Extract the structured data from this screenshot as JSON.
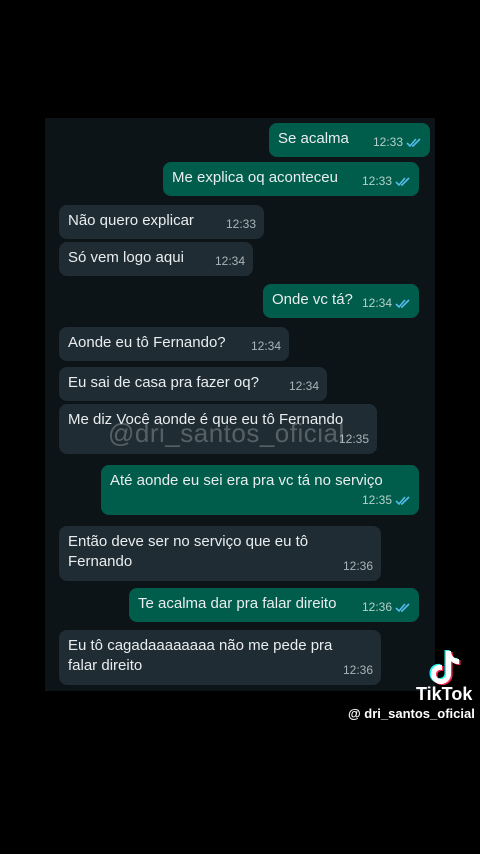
{
  "messages": [
    {
      "text": "Se acalma",
      "time": "12:33"
    },
    {
      "text": "Me explica oq aconteceu",
      "time": "12:33"
    },
    {
      "text": "Não quero explicar",
      "time": "12:33"
    },
    {
      "text": "Só vem logo aqui",
      "time": "12:34"
    },
    {
      "text": "Onde vc tá?",
      "time": "12:34"
    },
    {
      "text": "Aonde eu tô Fernando?",
      "time": "12:34"
    },
    {
      "text": "Eu sai de casa pra fazer oq?",
      "time": "12:34"
    },
    {
      "text": "Me diz Você aonde é que eu tô Fernando",
      "time": "12:35"
    },
    {
      "text": "Até aonde eu sei era pra vc tá no serviço",
      "time": "12:35"
    },
    {
      "line1": "Então deve ser no serviço que eu tô",
      "line2": "Fernando",
      "time": "12:36"
    },
    {
      "text": "Te acalma dar pra falar direito",
      "time": "12:36"
    },
    {
      "line1": "Eu tô cagadaaaaaaaa não me pede pra",
      "line2": "falar direito",
      "time": "12:36"
    }
  ],
  "watermark": "@dri_santos_oficial",
  "tiktok": {
    "brand": "TikTok",
    "handle": "@ dri_santos_oficial"
  },
  "colors": {
    "incoming": "#1f2c33",
    "outgoing": "#005c4b",
    "read_tick": "#53bdeb"
  }
}
